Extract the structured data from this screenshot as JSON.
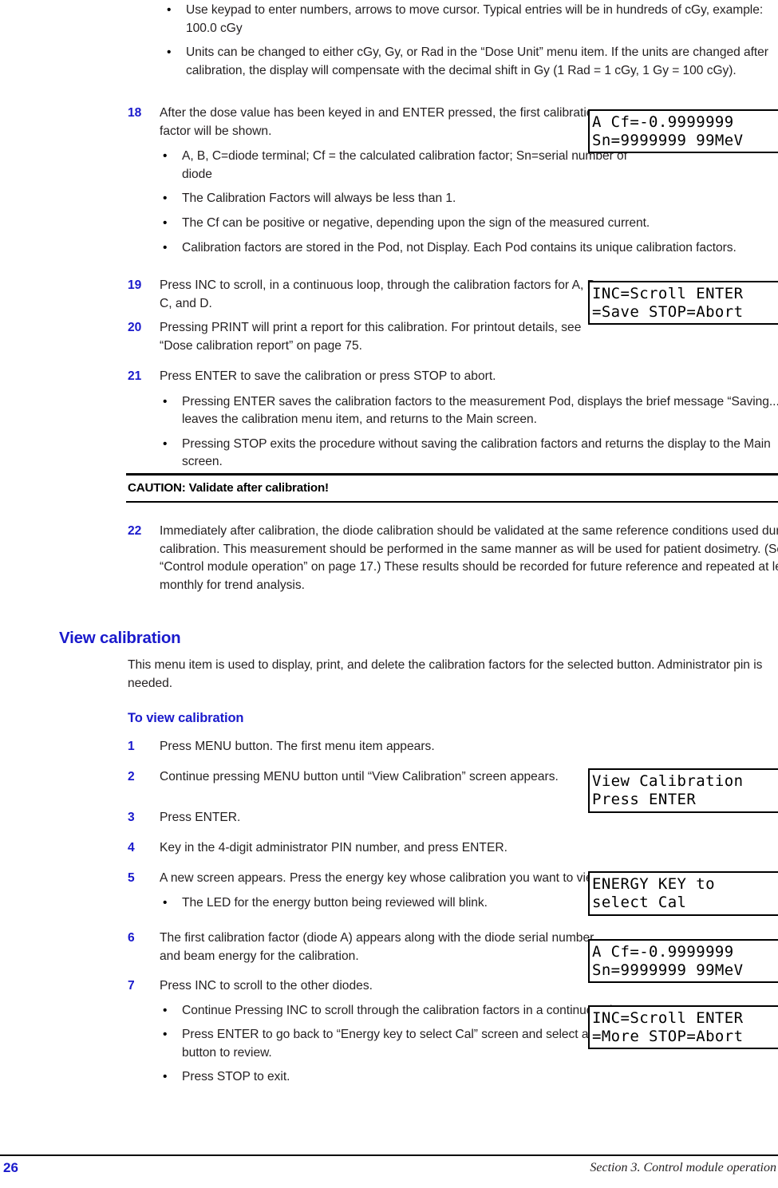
{
  "page": {
    "number": "26",
    "section_footer": "Section 3. Control module operation"
  },
  "intro_bullets": [
    "Use keypad to enter numbers, arrows to move cursor. Typical entries will be in hundreds of cGy, example: 100.0 cGy",
    "Units can be changed to either cGy, Gy, or Rad in the “Dose Unit” menu item. If the units are changed after calibration, the display will compensate with the decimal shift in Gy (1 Rad = 1 cGy, 1 Gy = 100 cGy)."
  ],
  "steps_calibrate": [
    {
      "num": "18",
      "text": "After the dose value has been keyed in and ENTER pressed, the first calibration factor will be shown.",
      "bullets": [
        "A, B, C=diode terminal; Cf = the calculated calibration factor; Sn=serial number of diode",
        "The Calibration Factors will always be less than 1.",
        "The Cf can be positive or negative, depending upon the sign of the measured current.",
        "Calibration factors are stored in the Pod, not Display. Each Pod contains its unique calibration factors."
      ]
    },
    {
      "num": "19",
      "text": "Press INC to scroll, in a continuous loop, through the calibration factors for A, B, C, and D.",
      "bullets": []
    },
    {
      "num": "20",
      "text": "Pressing PRINT will print a report for this calibration. For printout details, see “Dose calibration report” on page 75.",
      "bullets": []
    },
    {
      "num": "21",
      "text": "Press ENTER to save the calibration or press STOP to abort.",
      "bullets": [
        "Pressing ENTER saves the calibration factors to the measurement Pod, displays the brief message “Saving...,” leaves the calibration menu item, and returns to the Main screen.",
        "Pressing STOP exits the procedure without saving the calibration factors and returns the display to the Main screen."
      ]
    }
  ],
  "caution": {
    "text": "CAUTION: Validate after calibration!"
  },
  "step_22": {
    "num": "22",
    "text": "Immediately after calibration, the diode calibration should be validated at the same reference conditions used during calibration. This measurement should be performed in the same manner as will be used for patient dosimetry. (See “Control module operation” on page 17.) These results should be recorded for future reference and repeated at least monthly for trend analysis."
  },
  "view_calibration": {
    "heading": "View calibration",
    "intro": "This menu item is used to display, print, and delete the calibration factors for the selected button. Administrator pin is needed.",
    "subheading": "To view calibration",
    "steps": [
      {
        "num": "1",
        "text": "Press MENU button. The first menu item appears.",
        "bullets": []
      },
      {
        "num": "2",
        "text": "Continue pressing MENU button until “View Calibration” screen appears.",
        "bullets": []
      },
      {
        "num": "3",
        "text": "Press ENTER.",
        "bullets": []
      },
      {
        "num": "4",
        "text": "Key in the 4-digit administrator PIN number, and press ENTER.",
        "bullets": []
      },
      {
        "num": "5",
        "text": "A new screen appears. Press the energy key whose calibration you want to view.",
        "bullets": [
          "The LED for the energy button being reviewed will blink."
        ]
      },
      {
        "num": "6",
        "text": "The first calibration factor (diode A) appears along with the diode serial number and beam energy for the calibration.",
        "bullets": []
      },
      {
        "num": "7",
        "text": "Press INC to scroll to the other diodes.",
        "bullets": [
          "Continue Pressing INC to scroll through the calibration factors in a continuous loop.",
          "Press ENTER to go back to “Energy key to select Cal” screen and select another button to review.",
          "Press STOP to exit."
        ]
      }
    ]
  },
  "lcd_displays": [
    {
      "id": "lcd-cf-top",
      "line1": "A Cf=-0.9999999",
      "line2": "Sn=9999999 99MeV"
    },
    {
      "id": "lcd-scroll-save",
      "line1": "INC=Scroll ENTER",
      "line2": "=Save STOP=Abort"
    },
    {
      "id": "lcd-view-cal",
      "line1": "View Calibration",
      "line2": "Press ENTER"
    },
    {
      "id": "lcd-energy-key",
      "line1": "ENERGY KEY to",
      "line2": "select Cal"
    },
    {
      "id": "lcd-cf-bottom",
      "line1": "A Cf=-0.9999999",
      "line2": "Sn=9999999 99MeV"
    },
    {
      "id": "lcd-scroll-more",
      "line1": "INC=Scroll ENTER",
      "line2": "=More STOP=Abort"
    }
  ],
  "icons": {
    "bullet": "•"
  },
  "colors": {
    "accent_blue": "#1a1acc",
    "body_text": "#231f20"
  }
}
